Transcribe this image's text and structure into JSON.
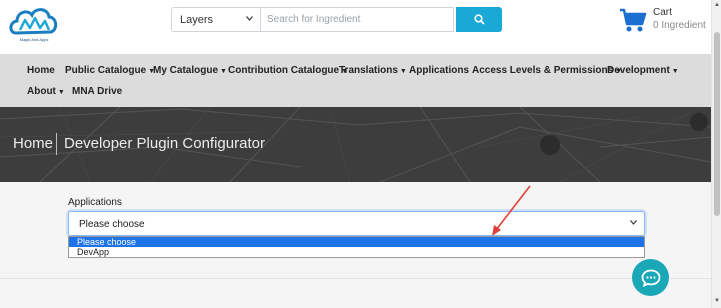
{
  "header": {
    "logo_text": "Magic And Apps",
    "search": {
      "category": "Layers",
      "placeholder": "Search for Ingredient"
    },
    "cart": {
      "title": "Cart",
      "count_label": "0 Ingredient"
    }
  },
  "nav": {
    "items": [
      {
        "label": "Home",
        "dropdown": false
      },
      {
        "label": "Public Catalogue",
        "dropdown": true
      },
      {
        "label": "My Catalogue",
        "dropdown": true
      },
      {
        "label": "Contribution Catalogue",
        "dropdown": true
      },
      {
        "label": "Translations",
        "dropdown": true
      },
      {
        "label": "Applications",
        "dropdown": false
      },
      {
        "label": "Access Levels & Permissions",
        "dropdown": true
      },
      {
        "label": "Development",
        "dropdown": true
      },
      {
        "label": "About",
        "dropdown": true
      },
      {
        "label": "MNA Drive",
        "dropdown": false
      }
    ],
    "caret": "▼"
  },
  "banner": {
    "home": "Home",
    "title": "Developer Plugin Configurator"
  },
  "form": {
    "applications_label": "Applications",
    "selected_value": "Please choose",
    "options": [
      {
        "label": "Please choose",
        "selected": true
      },
      {
        "label": "DevApp",
        "selected": false
      }
    ]
  },
  "colors": {
    "accent": "#1aa8d7",
    "nav_bg": "#dcdcdc",
    "banner_bg": "#3c3c3c",
    "selected_option": "#1e73e8",
    "chat": "#1aa8b8",
    "annotation_arrow": "#e0403a"
  },
  "icons": {
    "logo": "cloud-logo-icon",
    "search": "search-icon",
    "cart": "cart-icon",
    "chat": "chat-bubble-icon"
  }
}
